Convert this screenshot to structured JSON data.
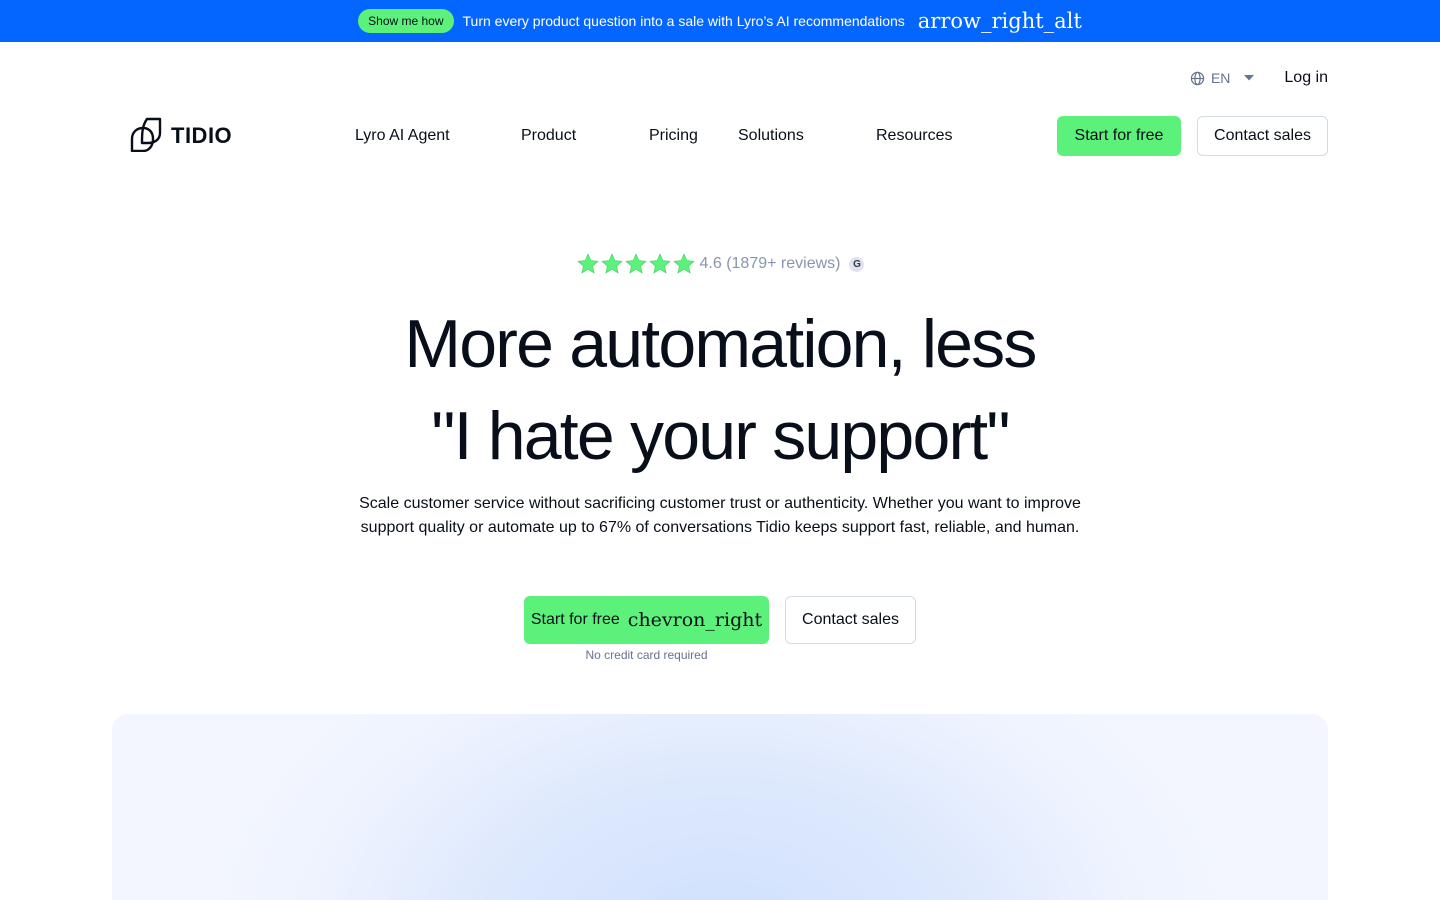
{
  "promo": {
    "pill_label": "Show me how",
    "message": "Turn every product question into a sale with Lyro’s AI recommendations",
    "arrow_icon": "arrow_right_alt"
  },
  "utility": {
    "language": "EN",
    "login_label": "Log in"
  },
  "nav": {
    "logo_text": "TIDIO",
    "items": [
      "Lyro AI Agent",
      "Product",
      "Pricing",
      "Solutions",
      "Resources"
    ],
    "start_label": "Start for free",
    "contact_label": "Contact sales"
  },
  "rating": {
    "stars": 5,
    "text": "4.6 (1879+ reviews)",
    "badge": "G"
  },
  "hero": {
    "headline_line1": "More automation, less",
    "headline_line2": "\"I hate your support\"",
    "subtext_line1": "Scale customer service without sacrificing customer trust or authenticity. Whether you want to improve",
    "subtext_line2": "support quality or automate up to 67% of conversations Tidio keeps support fast, reliable, and human.",
    "cta_start_label": "Start for free",
    "cta_start_icon": "chevron_right",
    "cta_contact_label": "Contact sales",
    "note": "No credit card required"
  },
  "colors": {
    "banner": "#0566ff",
    "accent_green": "#5cf17a",
    "text_dark": "#080f1a",
    "muted": "#8796af"
  }
}
